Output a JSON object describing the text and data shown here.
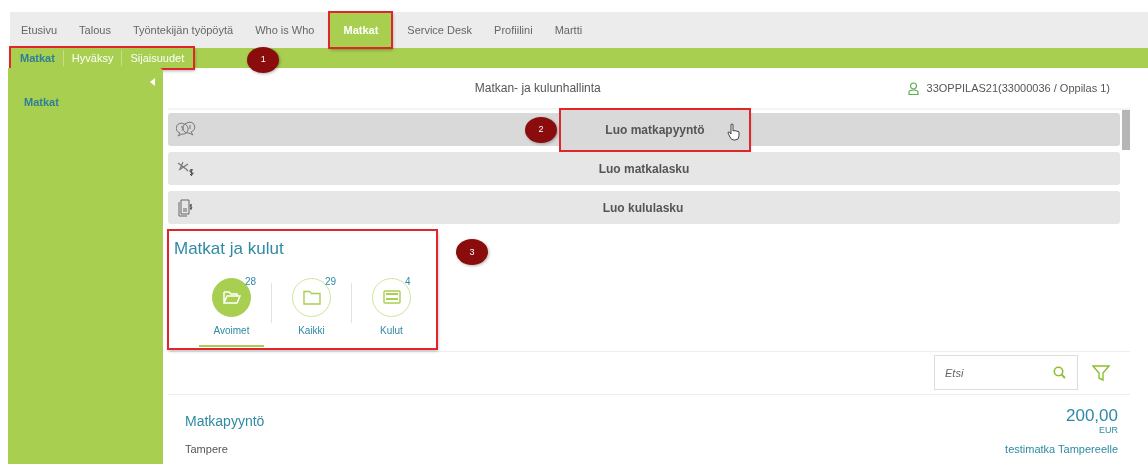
{
  "nav": {
    "tabs": [
      {
        "label": "Etusivu",
        "selected": false
      },
      {
        "label": "Talous",
        "selected": false
      },
      {
        "label": "Työntekijän työpöytä",
        "selected": false
      },
      {
        "label": "Who is Who",
        "selected": false
      },
      {
        "label": "Matkat",
        "selected": true,
        "highlighted": true
      },
      {
        "label": "Service Desk",
        "selected": false
      },
      {
        "label": "Profiilini",
        "selected": false
      },
      {
        "label": "Martti",
        "selected": false
      }
    ]
  },
  "subnav": {
    "highlighted": true,
    "callout": "1",
    "items": [
      {
        "label": "Matkat",
        "selected": true
      },
      {
        "label": "Hyväksy",
        "selected": false
      },
      {
        "label": "Sijaisuudet",
        "selected": false
      }
    ]
  },
  "sidebar": {
    "items": [
      {
        "label": "Matkat"
      }
    ]
  },
  "header": {
    "title": "Matkan- ja kulunhallinta",
    "user": "33OPPILAS21(33000036 / Oppilas 1)"
  },
  "actions": [
    {
      "kind": "request",
      "label": "Luo matkapyyntö",
      "hovered": true,
      "highlighted": true,
      "callout": "2"
    },
    {
      "kind": "travel",
      "label": "Luo matkalasku",
      "hovered": false,
      "highlighted": false
    },
    {
      "kind": "expense",
      "label": "Luo kululasku",
      "hovered": false,
      "highlighted": false
    }
  ],
  "section": {
    "title": "Matkat ja kulut",
    "highlighted": true,
    "callout": "3",
    "counters": [
      {
        "kind": "open",
        "label": "Avoimet",
        "count": "28",
        "selected": true
      },
      {
        "kind": "all",
        "label": "Kaikki",
        "count": "29",
        "selected": false
      },
      {
        "kind": "expenses",
        "label": "Kulut",
        "count": "4",
        "selected": false
      }
    ]
  },
  "search": {
    "placeholder": "Etsi"
  },
  "list": [
    {
      "title": "Matkapyyntö",
      "amount": "200,00",
      "currency": "EUR",
      "location": "Tampere",
      "description": "testimatka Tampereelle"
    }
  ]
}
